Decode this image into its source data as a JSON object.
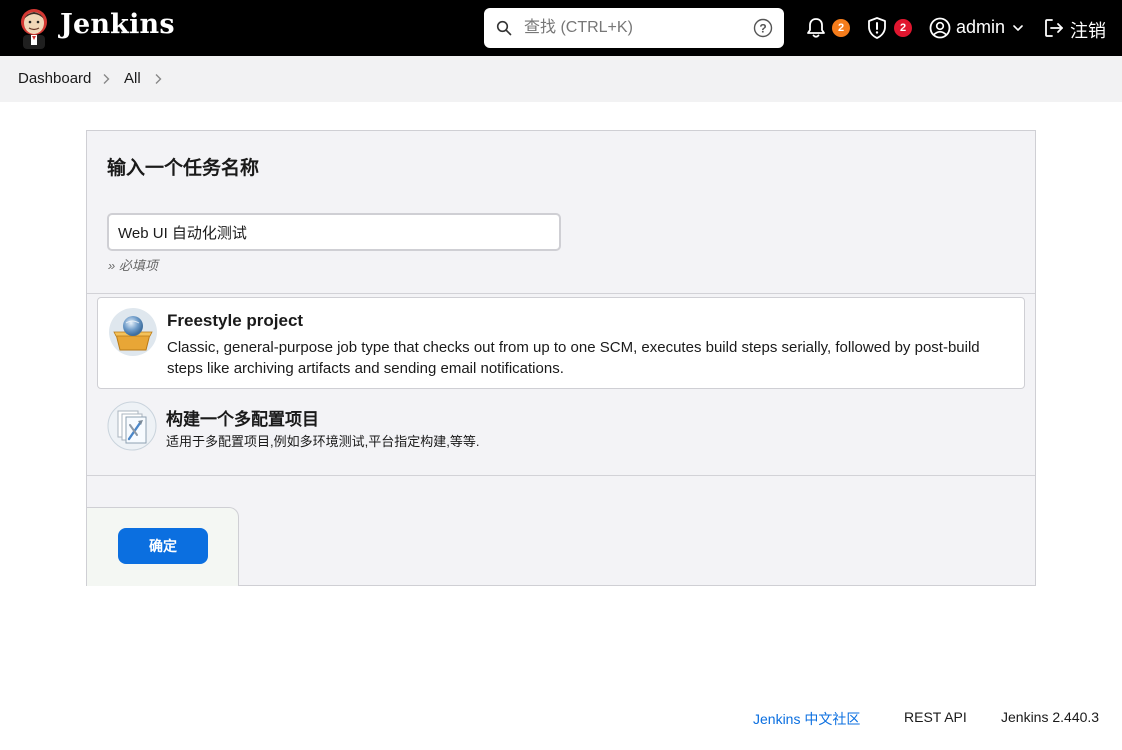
{
  "header": {
    "brand": "Jenkins",
    "search_placeholder": "查找 (CTRL+K)",
    "notifications_count": "2",
    "security_count": "2",
    "user": "admin",
    "logout": "注销",
    "icons": [
      "jenkins-logo-icon",
      "search-icon",
      "help-icon",
      "bell-icon",
      "shield-alert-icon",
      "user-circle-icon",
      "chevron-down-icon",
      "logout-icon"
    ]
  },
  "breadcrumb": [
    {
      "label": "Dashboard"
    },
    {
      "label": "All"
    }
  ],
  "form": {
    "title": "输入一个任务名称",
    "name_value": "Web UI 自动化测试",
    "required_note": "» 必填项",
    "job_types": [
      {
        "title": "Freestyle project",
        "description": "Classic, general-purpose job type that checks out from up to one SCM, executes build steps serially, followed by post-build steps like archiving artifacts and sending email notifications.",
        "icon": "freestyle-project-icon",
        "selected": true
      },
      {
        "title": "构建一个多配置项目",
        "description": "适用于多配置项目,例如多环境测试,平台指定构建,等等.",
        "icon": "multi-configuration-icon",
        "selected": false
      }
    ],
    "ok_label": "确定"
  },
  "footer": {
    "community": "Jenkins 中文社区",
    "rest_api": "REST API",
    "version": "Jenkins 2.440.3"
  },
  "colors": {
    "header_bg": "#000000",
    "accent": "#0b6fe0",
    "badge_warning": "#f57c1b",
    "badge_danger": "#e0162f",
    "link": "#0b6fe0"
  }
}
